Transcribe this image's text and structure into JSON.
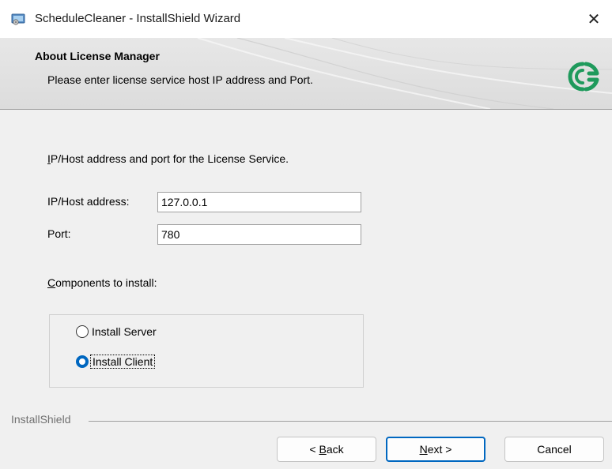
{
  "window": {
    "title": "ScheduleCleaner - InstallShield Wizard",
    "close_glyph": "✕"
  },
  "banner": {
    "title": "About License Manager",
    "subtitle": "Please enter license service host IP address and Port.",
    "logo_icon": "green-circular-logo-icon"
  },
  "content": {
    "intro_accel": "I",
    "intro_rest": "P/Host address and port for the License Service.",
    "ip_label": "IP/Host address:",
    "ip_value": "127.0.0.1",
    "port_label": "Port:",
    "port_value": "780",
    "components_accel": "C",
    "components_rest": "omponents to install:",
    "options": {
      "server": {
        "label": "Install Server",
        "checked": false
      },
      "client": {
        "label": "Install Client",
        "checked": true
      }
    }
  },
  "footer": {
    "brand": "InstallShield",
    "back_prefix": "< ",
    "back_accel": "B",
    "back_rest": "ack",
    "next_accel": "N",
    "next_rest": "ext >",
    "cancel": "Cancel"
  },
  "colors": {
    "accent": "#0067c0",
    "logo_green": "#1f9a5c"
  }
}
